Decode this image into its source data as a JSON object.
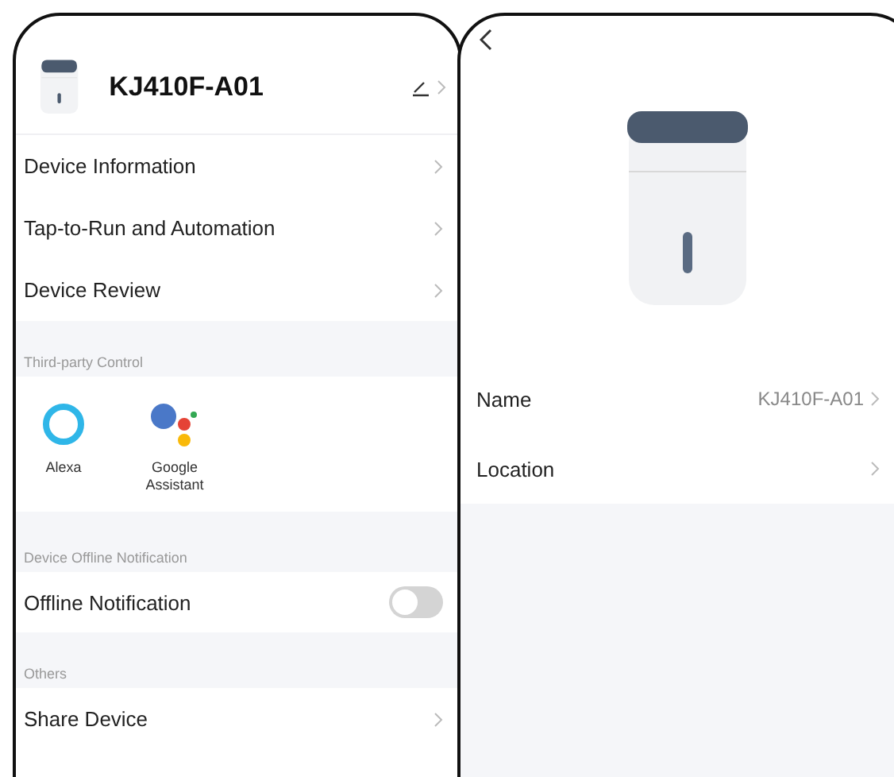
{
  "device_screen": {
    "title": "KJ410F-A01",
    "menu_items": [
      {
        "label": "Device Information"
      },
      {
        "label": "Tap-to-Run and Automation"
      },
      {
        "label": "Device Review"
      }
    ],
    "third_party": {
      "heading": "Third-party Control",
      "services": [
        {
          "kind": "alexa",
          "label": "Alexa"
        },
        {
          "kind": "google",
          "label": "Google Assistant"
        }
      ]
    },
    "offline": {
      "heading": "Device Offline Notification",
      "label": "Offline Notification",
      "on": false
    },
    "others": {
      "heading": "Others",
      "items": [
        {
          "label": "Share Device"
        }
      ]
    }
  },
  "info_screen": {
    "rows": [
      {
        "label": "Name",
        "value": "KJ410F-A01"
      },
      {
        "label": "Location"
      }
    ]
  }
}
